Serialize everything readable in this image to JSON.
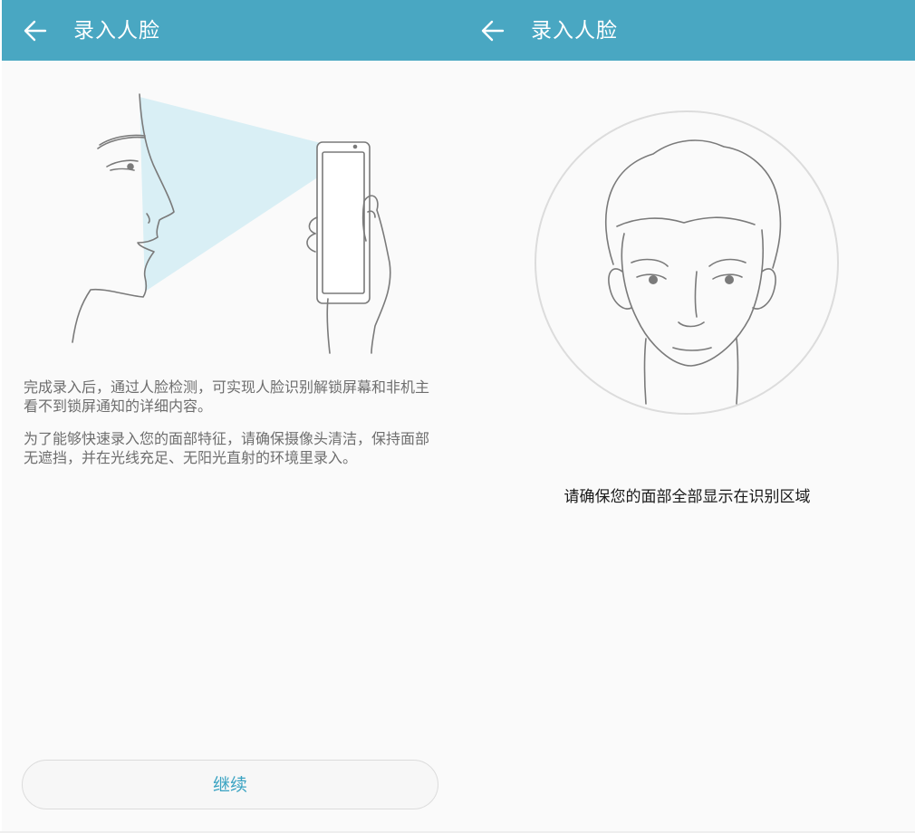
{
  "left_screen": {
    "header": {
      "title": "录入人脸",
      "back_icon": "arrow-left-icon"
    },
    "illustration": "face-profile-holding-phone",
    "paragraphs": [
      "完成录入后，通过人脸检测，可实现人脸识别解锁屏幕和非机主看不到锁屏通知的详细内容。",
      "为了能够快速录入您的面部特征，请确保摄像头清洁，保持面部无遮挡，并在光线充足、无阳光直射的环境里录入。"
    ],
    "continue_button": "继续"
  },
  "right_screen": {
    "header": {
      "title": "录入人脸",
      "back_icon": "arrow-left-icon"
    },
    "illustration": "front-face-in-circle",
    "hint": "请确保您的面部全部显示在识别区域"
  },
  "colors": {
    "header_bg": "#49a7c2",
    "button_text": "#3aa3c2",
    "body_text": "#6e6e6e",
    "hint_text": "#1a1a1a",
    "light_beam": "#d9eff5"
  }
}
